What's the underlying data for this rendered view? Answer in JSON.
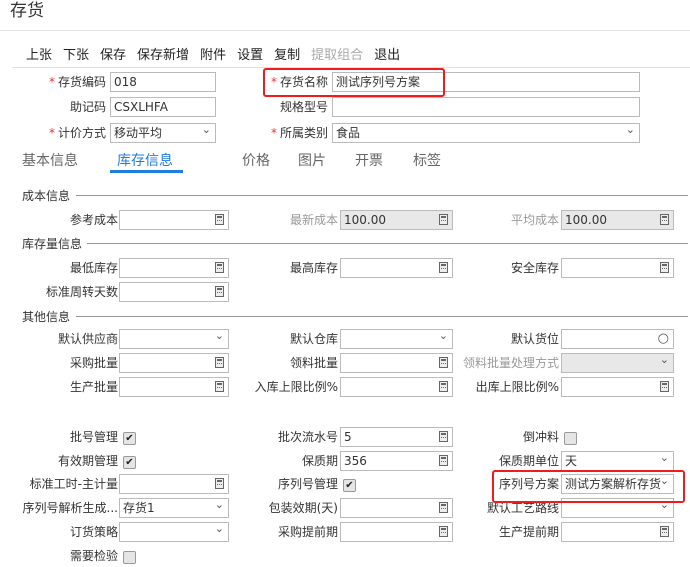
{
  "title": "存货",
  "toolbar": [
    {
      "label": "上张"
    },
    {
      "label": "下张"
    },
    {
      "label": "保存"
    },
    {
      "label": "保存新增"
    },
    {
      "label": "附件"
    },
    {
      "label": "设置"
    },
    {
      "label": "复制"
    },
    {
      "label": "提取组合",
      "disabled": true
    },
    {
      "label": "退出"
    }
  ],
  "header_fields": [
    {
      "label": "存货编码",
      "value": "018",
      "required": true,
      "type": "text"
    },
    {
      "label": "存货名称",
      "value": "测试序列号方案",
      "required": true,
      "type": "text"
    },
    {
      "label": "助记码",
      "value": "CSXLHFA",
      "type": "text"
    },
    {
      "label": "规格型号",
      "value": "",
      "type": "text"
    },
    {
      "label": "计价方式",
      "value": "移动平均",
      "required": true,
      "type": "select"
    },
    {
      "label": "所属类别",
      "value": "食品",
      "required": true,
      "type": "select"
    }
  ],
  "tabs": [
    {
      "label": "基本信息"
    },
    {
      "label": "库存信息",
      "active": true
    },
    {
      "label": "价格"
    },
    {
      "label": "图片"
    },
    {
      "label": "开票"
    },
    {
      "label": "标签"
    }
  ],
  "sections": {
    "cost": "成本信息",
    "stock": "库存量信息",
    "other": "其他信息"
  },
  "fields": [
    {
      "label": "参考成本",
      "type": "calc",
      "value": ""
    },
    {
      "label": "最新成本",
      "type": "calc",
      "value": "100.00",
      "disabled": true
    },
    {
      "label": "平均成本",
      "type": "calc",
      "value": "100.00",
      "disabled": true
    },
    {
      "label": "最低库存",
      "type": "calc",
      "value": ""
    },
    {
      "label": "最高库存",
      "type": "calc",
      "value": ""
    },
    {
      "label": "安全库存",
      "type": "calc",
      "value": ""
    },
    {
      "label": "标准周转天数",
      "type": "calc",
      "value": ""
    },
    {
      "label": "默认供应商",
      "type": "select",
      "value": ""
    },
    {
      "label": "默认仓库",
      "type": "select",
      "value": ""
    },
    {
      "label": "默认货位",
      "type": "search",
      "value": ""
    },
    {
      "label": "采购批量",
      "type": "calc",
      "value": ""
    },
    {
      "label": "领料批量",
      "type": "calc",
      "value": ""
    },
    {
      "label": "领料批量处理方式",
      "type": "select",
      "value": "",
      "disabled": true
    },
    {
      "label": "生产批量",
      "type": "calc",
      "value": ""
    },
    {
      "label": "入库上限比例%",
      "type": "calc",
      "value": ""
    },
    {
      "label": "出库上限比例%",
      "type": "calc",
      "value": ""
    },
    {
      "label": "批号管理",
      "type": "check",
      "checked": true
    },
    {
      "label": "批次流水号",
      "type": "calc",
      "value": "5"
    },
    {
      "label": "倒冲料",
      "type": "check",
      "checked": false
    },
    {
      "label": "有效期管理",
      "type": "check",
      "checked": true
    },
    {
      "label": "保质期",
      "type": "calc",
      "value": "356"
    },
    {
      "label": "保质期单位",
      "type": "select",
      "value": "天"
    },
    {
      "label": "标准工时-主计量",
      "type": "calc",
      "value": ""
    },
    {
      "label": "序列号管理",
      "type": "check",
      "checked": true
    },
    {
      "label": "序列号方案",
      "type": "select",
      "value": "测试方案解析存货"
    },
    {
      "label": "序列号解析生成...",
      "type": "select",
      "value": "存货1"
    },
    {
      "label": "包装效期(天)",
      "type": "calc",
      "value": ""
    },
    {
      "label": "默认工艺路线",
      "type": "select",
      "value": ""
    },
    {
      "label": "订货策略",
      "type": "select",
      "value": ""
    },
    {
      "label": "采购提前期",
      "type": "calc",
      "value": ""
    },
    {
      "label": "生产提前期",
      "type": "calc",
      "value": ""
    },
    {
      "label": "需要检验",
      "type": "check",
      "checked": false
    }
  ]
}
